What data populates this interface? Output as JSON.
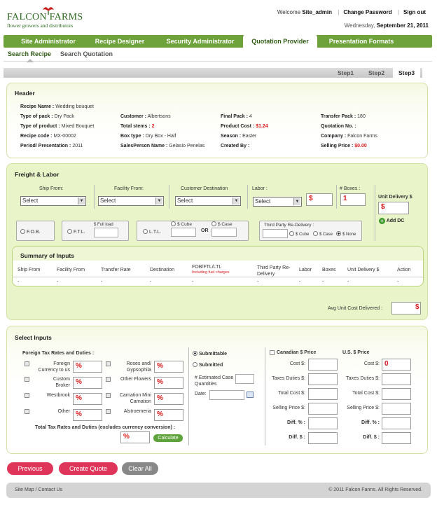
{
  "header": {
    "logo_brand": "FALCON FARMS",
    "logo_tagline": "flower growers and distributors",
    "welcome_prefix": "Welcome",
    "user": "Site_admin",
    "change_password": "Change Password",
    "sign_out": "Sign out",
    "date_prefix": "Wednesday,",
    "date": "September 21, 2011"
  },
  "nav": {
    "tabs": [
      "Site Administrator",
      "Recipe Designer",
      "Security Administrator",
      "Quotation Provider",
      "Presentation Formats"
    ],
    "active": "Quotation Provider"
  },
  "subnav": [
    "Search Recipe",
    "Search Quotation"
  ],
  "steps": [
    "Step1",
    "Step2",
    "Step3"
  ],
  "header_panel": {
    "title": "Header",
    "recipe_name_label": "Recipe Name :",
    "recipe_name": "Wedding bouquet",
    "type_pack_label": "Type of pack :",
    "type_pack": "Dry Pack",
    "type_product_label": "Type of product :",
    "type_product": "Mixed Bouquet",
    "recipe_code_label": "Recipe code :",
    "recipe_code": "MX-00002",
    "period_label": "Period/ Presentation :",
    "period": "2011",
    "customer_label": "Customer :",
    "customer": "Albertsons",
    "total_stems_label": "Total stems :",
    "total_stems": "2",
    "box_type_label": "Box type :",
    "box_type": "Dry Box - Half",
    "salesperson_label": "SalesPerson Name :",
    "salesperson": "Gelasio Penelas",
    "final_pack_label": "Final Pack :",
    "final_pack": "4",
    "product_cost_label": "Product Cost :",
    "product_cost": "$1.24",
    "season_label": "Season :",
    "season": "Easter",
    "created_by_label": "Created By :",
    "created_by": "",
    "transfer_pack_label": "Transfer Pack :",
    "transfer_pack": "180",
    "quotation_no_label": "Quotation No. :",
    "quotation_no": "",
    "company_label": "Company :",
    "company": "Falcon Farms",
    "selling_price_label": "Selling Price :",
    "selling_price": "$0.00"
  },
  "freight": {
    "title": "Freight & Labor",
    "ship_from_label": "Ship From:",
    "facility_from_label": "Facility From:",
    "customer_dest_label": "Customer Destination",
    "labor_label": "Labor :",
    "boxes_label": "# Boxes :",
    "unit_delivery_label": "Unit Delivery $",
    "select_text": "Select",
    "dollar": "$",
    "boxes_value": "1",
    "add_dc": "Add DC",
    "fob": "F.O.B.",
    "ftl": "F.T.L.",
    "full_load": "$ Full load",
    "ltl": "L.T.L.",
    "cube": "$ Cube",
    "case": "$ Case",
    "or": "OR",
    "third_party": "Third Party Re-Delivery :",
    "tp_cube": "$ Cube",
    "tp_case": "$ Case",
    "tp_none": "$ None",
    "summary_title": "Summary of Inputs",
    "summary_headers": [
      "Ship From",
      "Facility From",
      "Transfer Rate",
      "Destination",
      "FOB/FTL/LTL",
      "Third Party Re-Delivery",
      "Labor",
      "Boxes",
      "Unit Delivery $",
      "Action"
    ],
    "fuel_note": "Including fuel charges",
    "dash": "-",
    "avg_cost_label": "Avg Unit Cost Delivered :"
  },
  "inputs": {
    "title": "Select Inputs",
    "foreign_title": "Foreign Tax Rates and Duties :",
    "left_items": [
      "Foreign Currency to us",
      "Custom Broker",
      "Westbrook",
      "Other"
    ],
    "right_items": [
      "Roses and/ Gypsophila",
      "Other Flowers",
      "Carnation Mini Carnation",
      "Alstroemeria"
    ],
    "pct": "%",
    "total_label": "Total Tax Rates and Duties (excludes currency conversion) :",
    "calculate": "Calculate",
    "submittable": "Submittable",
    "submitted": "Submitted",
    "estimated": "# Estimated Case Quantities",
    "date_label": "Date:",
    "cad_title": "Canadian $ Price",
    "usd_title": "U.S. $ Price",
    "price_rows": [
      "Cost $:",
      "Taxes Duties $:",
      "Total Cost $:",
      "Selling Price $:",
      "Diff. % :",
      "Diff. $ :"
    ],
    "usd_cost_value": "0"
  },
  "buttons": {
    "previous": "Previous",
    "create_quote": "Create Quote",
    "clear_all": "Clear All"
  },
  "footer": {
    "links": "Site Map / Contact Us",
    "copyright": "© 2011 Falcon Farms. All Rights Reserved."
  },
  "colors": {
    "nav_green": "#6ea23a",
    "accent_red": "#d81a1a",
    "button_pink": "#e0355a",
    "button_gray": "#888888"
  }
}
